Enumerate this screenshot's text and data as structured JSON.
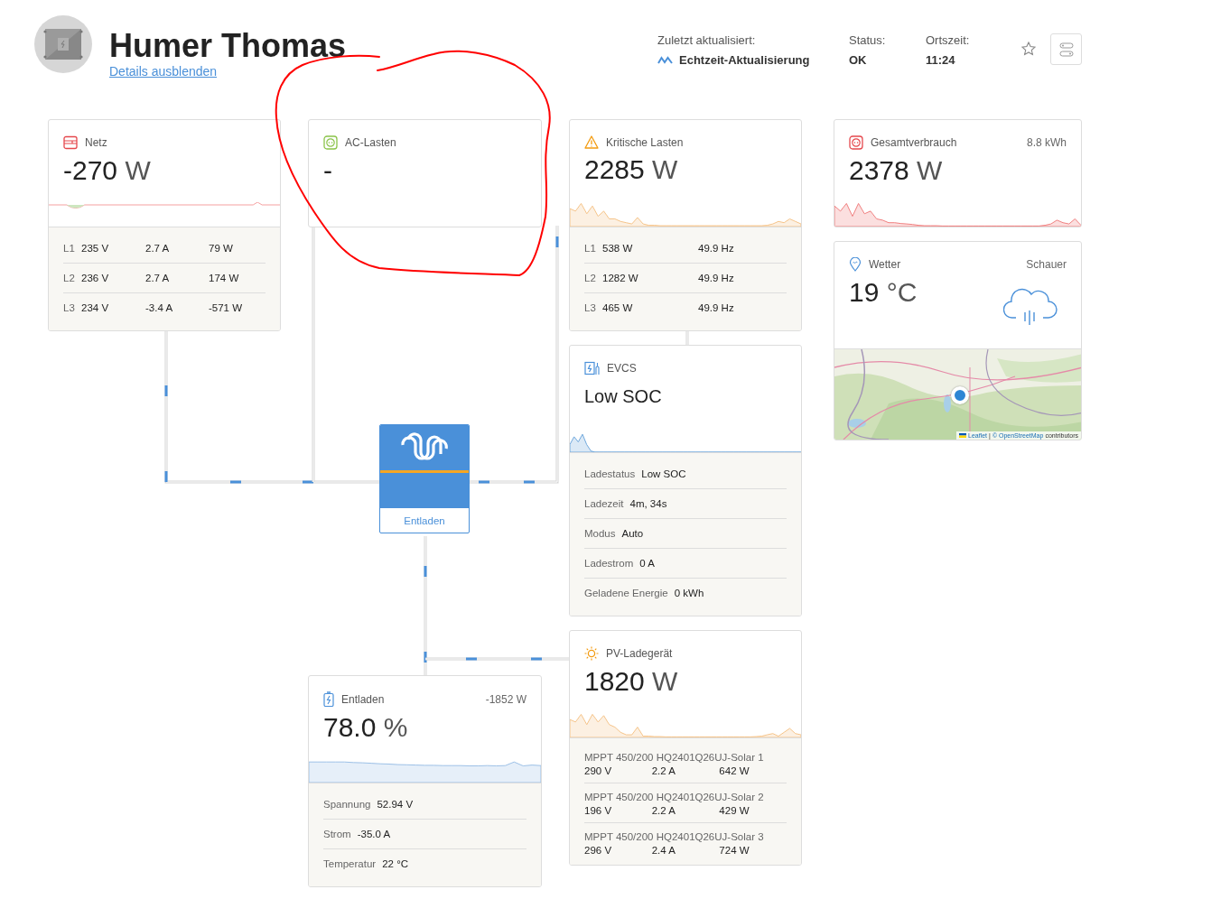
{
  "header": {
    "name": "Humer Thomas",
    "details_link": "Details ausblenden",
    "updated_label": "Zuletzt aktualisiert:",
    "updated_value": "Echtzeit-Aktualisierung",
    "status_label": "Status:",
    "status_value": "OK",
    "time_label": "Ortszeit:",
    "time_value": "11:24",
    "favorite": false
  },
  "cards": [
    {
      "kind": "phases",
      "title": "Netz",
      "value": "-270",
      "unit": "W",
      "rows": [
        {
          "phase": "L1",
          "cells": [
            "235 V",
            "2.7 A",
            "79 W"
          ]
        },
        {
          "phase": "L2",
          "cells": [
            "236 V",
            "2.7 A",
            "174 W"
          ]
        },
        {
          "phase": "L3",
          "cells": [
            "234 V",
            "-3.4 A",
            "-571 W"
          ]
        }
      ]
    },
    {
      "kind": "simple",
      "title": "AC-Lasten",
      "value": "-"
    },
    {
      "kind": "phases",
      "title": "Kritische Lasten",
      "value": "2285",
      "unit": "W",
      "rows": [
        {
          "phase": "L1",
          "cells": [
            "538 W",
            "49.9 Hz"
          ]
        },
        {
          "phase": "L2",
          "cells": [
            "1282 W",
            "49.9 Hz"
          ]
        },
        {
          "phase": "L3",
          "cells": [
            "465 W",
            "49.9 Hz"
          ]
        }
      ]
    },
    {
      "kind": "simple",
      "title": "Gesamtverbrauch",
      "extra": "8.8 kWh",
      "value": "2378",
      "unit": "W"
    },
    {
      "kind": "weather",
      "title": "Wetter",
      "extra": "Schauer",
      "value": "19",
      "unit": "°C",
      "map_attribution": {
        "library": "Leaflet",
        "divider": "|",
        "source": "© OpenStreetMap",
        "suffix": "contributors"
      }
    },
    {
      "kind": "status",
      "title": "EVCS",
      "value": "Low SOC",
      "rows": [
        {
          "label": "Ladestatus",
          "value": "Low SOC"
        },
        {
          "label": "Ladezeit",
          "value": "4m, 34s"
        },
        {
          "label": "Modus",
          "value": "Auto"
        },
        {
          "label": "Ladestrom",
          "value": "0 A"
        },
        {
          "label": "Geladene Energie",
          "value": "0 kWh"
        }
      ]
    },
    {
      "kind": "inverter",
      "label": "Entladen"
    },
    {
      "kind": "mppt",
      "title": "PV-Ladegerät",
      "value": "1820",
      "unit": "W",
      "rows": [
        {
          "name": "MPPT 450/200 HQ2401Q26UJ-Solar 1",
          "cells": [
            "290 V",
            "2.2 A",
            "642 W"
          ]
        },
        {
          "name": "MPPT 450/200 HQ2401Q26UJ-Solar 2",
          "cells": [
            "196 V",
            "2.2 A",
            "429 W"
          ]
        },
        {
          "name": "MPPT 450/200 HQ2401Q26UJ-Solar 3",
          "cells": [
            "296 V",
            "2.4 A",
            "724 W"
          ]
        }
      ]
    },
    {
      "kind": "details",
      "title": "Entladen",
      "extra": "-1852 W",
      "value": "78.0",
      "unit": "%",
      "rows": [
        {
          "label": "Spannung",
          "value": "52.94 V"
        },
        {
          "label": "Strom",
          "value": "-35.0 A"
        },
        {
          "label": "Temperatur",
          "value": "22 °C"
        }
      ]
    }
  ]
}
